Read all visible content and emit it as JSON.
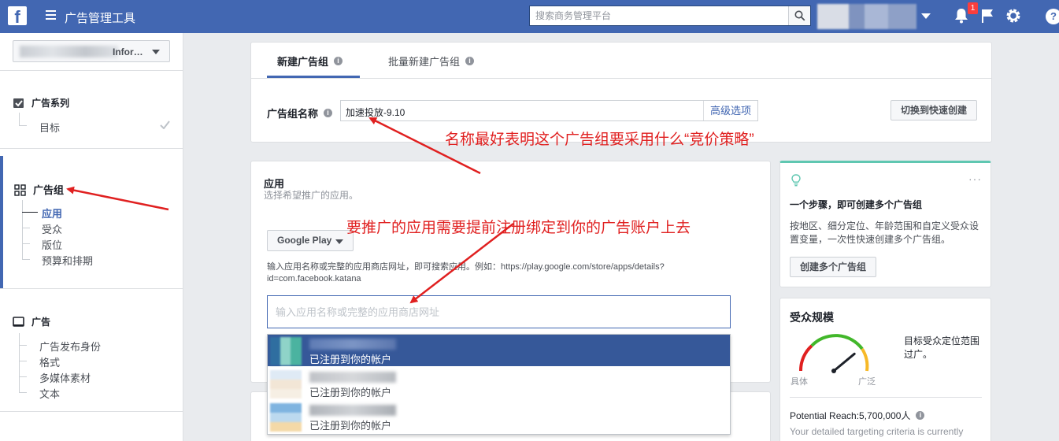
{
  "topbar": {
    "logo": "f",
    "title": "广告管理工具",
    "search_placeholder": "搜索商务管理平台",
    "notification_count": "1"
  },
  "sidebar": {
    "account_label": "Infor…",
    "campaign": {
      "label": "广告系列",
      "items": [
        "目标"
      ]
    },
    "adset": {
      "label": "广告组",
      "items": [
        "应用",
        "受众",
        "版位",
        "预算和排期"
      ],
      "current": "应用"
    },
    "ad": {
      "label": "广告",
      "items": [
        "广告发布身份",
        "格式",
        "多媒体素材",
        "文本"
      ]
    }
  },
  "tabs": {
    "new": "新建广告组",
    "bulk": "批量新建广告组"
  },
  "name_row": {
    "label": "广告组名称",
    "value": "加速投放-9.10",
    "advanced": "高级选项",
    "switch_button": "切换到快速创建"
  },
  "app_section": {
    "title": "应用",
    "subtitle": "选择希望推广的应用。",
    "store": "Google Play",
    "hint": "输入应用名称或完整的应用商店网址，即可搜索应用。例如：https://play.google.com/store/apps/details?id=com.facebook.katana",
    "input_placeholder": "输入应用名称或完整的应用商店网址",
    "results": [
      {
        "status": "已注册到你的帐户"
      },
      {
        "status": "已注册到你的帐户"
      },
      {
        "status": "已注册到你的帐户"
      }
    ]
  },
  "tip_card": {
    "title": "一个步骤，即可创建多个广告组",
    "text": "按地区、细分定位、年龄范围和自定义受众设置变量，一次性快速创建多个广告组。",
    "button": "创建多个广告组"
  },
  "audience": {
    "title": "受众规模",
    "description": "目标受众定位范围过广。",
    "gauge_left": "具体",
    "gauge_right": "广泛",
    "gauge_level": 0.78,
    "potential_reach": "Potential Reach:5,700,000人",
    "note": "Your detailed targeting criteria is currently"
  },
  "annotations": {
    "name_tip": "名称最好表明这个广告组要采用什么“竞价策略”",
    "app_tip": "要推广的应用需要提前注册绑定到你的广告账户上去"
  },
  "colors": {
    "brand": "#4267b2",
    "selected": "#365899",
    "annotation": "#e02020",
    "tip_accent": "#5fc7b1"
  }
}
